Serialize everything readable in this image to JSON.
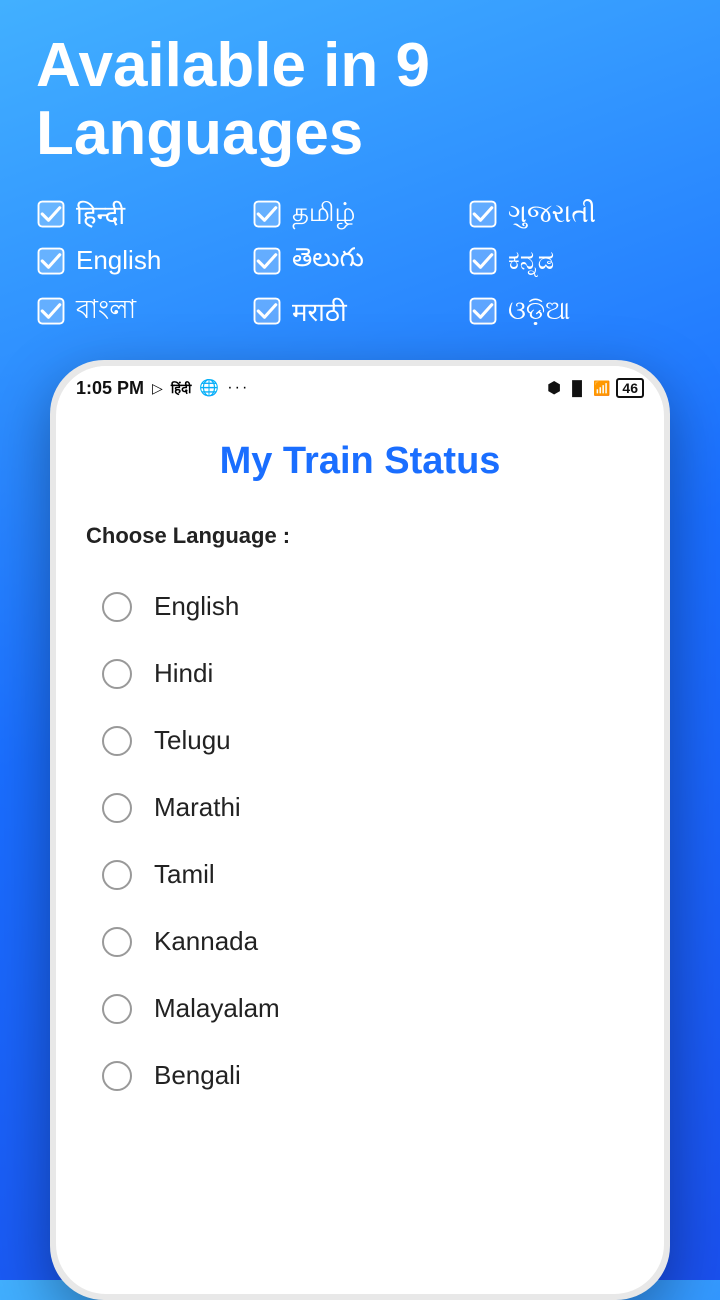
{
  "header": {
    "title": "Available in 9 Languages"
  },
  "language_badges": [
    {
      "label": "हिन्दी"
    },
    {
      "label": "தமிழ்"
    },
    {
      "label": "ગુજરાતી"
    },
    {
      "label": "English"
    },
    {
      "label": "తెలుగు"
    },
    {
      "label": "ಕನ್ನಡ"
    },
    {
      "label": "বাংলা"
    },
    {
      "label": "मराठी"
    },
    {
      "label": "ଓଡ଼ିଆ"
    }
  ],
  "status_bar": {
    "time": "1:05 PM",
    "battery": "46"
  },
  "app": {
    "title": "My Train Status",
    "choose_label": "Choose Language :",
    "languages": [
      {
        "name": "English"
      },
      {
        "name": "Hindi"
      },
      {
        "name": "Telugu"
      },
      {
        "name": "Marathi"
      },
      {
        "name": "Tamil"
      },
      {
        "name": "Kannada"
      },
      {
        "name": "Malayalam"
      },
      {
        "name": "Bengali"
      }
    ]
  }
}
